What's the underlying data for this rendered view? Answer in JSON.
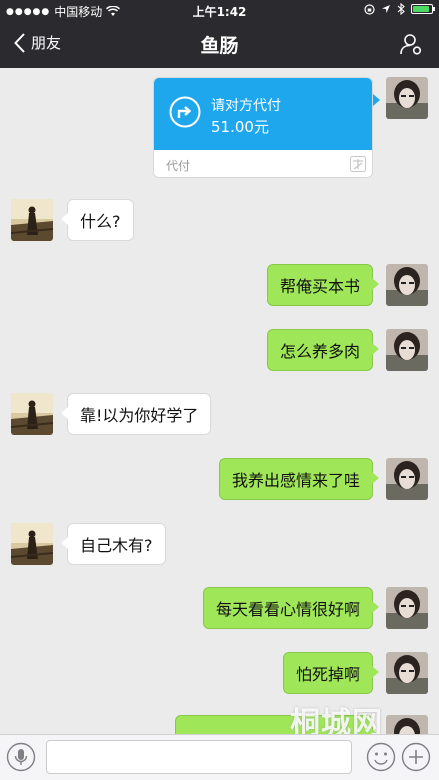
{
  "status_bar": {
    "carrier": "中国移动",
    "time": "上午1:42"
  },
  "nav": {
    "back_label": "朋友",
    "title": "鱼肠"
  },
  "payment_card": {
    "title": "请对方代付",
    "amount": "51.00元",
    "label": "代付"
  },
  "messages": [
    {
      "side": "left",
      "text": "什么?"
    },
    {
      "side": "right",
      "text": "帮俺买本书"
    },
    {
      "side": "right",
      "text": "怎么养多肉"
    },
    {
      "side": "left",
      "text": "靠!以为你好学了"
    },
    {
      "side": "right",
      "text": "我养出感情来了哇"
    },
    {
      "side": "left",
      "text": "自己木有?"
    },
    {
      "side": "right",
      "text": "每天看看心情很好啊"
    },
    {
      "side": "right",
      "text": "怕死掉啊"
    },
    {
      "side": "right",
      "text": ""
    }
  ],
  "watermark": "桐城网",
  "colors": {
    "nav_bg": "#2b2b2f",
    "chat_bg": "#ebebeb",
    "green_bubble": "#9fe658",
    "pay_blue": "#1ea7ec"
  },
  "icons": [
    "wifi-icon",
    "lock-rotation-icon",
    "location-icon",
    "bluetooth-icon",
    "battery-icon",
    "back-chevron-icon",
    "profile-icon",
    "transfer-icon",
    "voice-icon",
    "emoji-icon",
    "plus-icon"
  ]
}
